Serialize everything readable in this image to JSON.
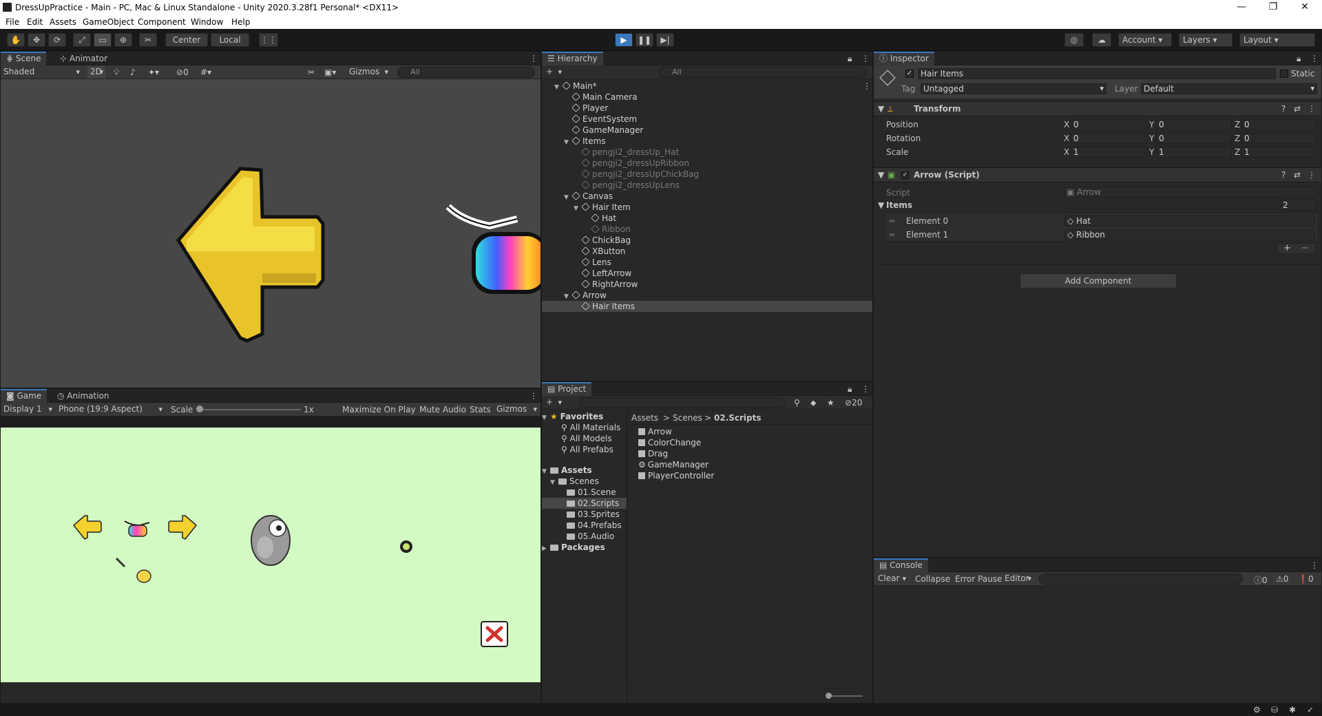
{
  "window": {
    "title": "DressUpPractice - Main - PC, Mac & Linux Standalone - Unity 2020.3.28f1 Personal* <DX11>"
  },
  "menu": [
    "File",
    "Edit",
    "Assets",
    "GameObject",
    "Component",
    "Window",
    "Help"
  ],
  "toolbar": {
    "center": "Center",
    "local": "Local",
    "account": "Account",
    "layers": "Layers",
    "layout": "Layout"
  },
  "scene": {
    "tabs": [
      "Scene",
      "Animator"
    ],
    "shading": "Shaded",
    "mode2d": "2D",
    "hidden_count": "0",
    "gizmos": "Gizmos",
    "search_placeholder": "All"
  },
  "hierarchy": {
    "tab": "Hierarchy",
    "search_placeholder": "All",
    "items": [
      {
        "label": "Main*",
        "level": 0,
        "fold": "open",
        "kind": "scene"
      },
      {
        "label": "Main Camera",
        "level": 1
      },
      {
        "label": "Player",
        "level": 1
      },
      {
        "label": "EventSystem",
        "level": 1
      },
      {
        "label": "GameManager",
        "level": 1
      },
      {
        "label": "Items",
        "level": 1,
        "fold": "open"
      },
      {
        "label": "pengji2_dressUp_Hat",
        "level": 2,
        "dim": true
      },
      {
        "label": "pengji2_dressUpRibbon",
        "level": 2,
        "dim": true
      },
      {
        "label": "pengji2_dressUpChickBag",
        "level": 2,
        "dim": true
      },
      {
        "label": "pengji2_dressUpLens",
        "level": 2,
        "dim": true
      },
      {
        "label": "Canvas",
        "level": 1,
        "fold": "open"
      },
      {
        "label": "Hair Item",
        "level": 2,
        "fold": "open"
      },
      {
        "label": "Hat",
        "level": 3
      },
      {
        "label": "Ribbon",
        "level": 3,
        "dim": true
      },
      {
        "label": "ChickBag",
        "level": 2
      },
      {
        "label": "XButton",
        "level": 2
      },
      {
        "label": "Lens",
        "level": 2
      },
      {
        "label": "LeftArrow",
        "level": 2
      },
      {
        "label": "RightArrow",
        "level": 2
      },
      {
        "label": "Arrow",
        "level": 1,
        "fold": "open"
      },
      {
        "label": "Hair Items",
        "level": 2,
        "selected": true
      }
    ]
  },
  "inspector": {
    "tab": "Inspector",
    "object_name": "Hair Items",
    "static_label": "Static",
    "tag_label": "Tag",
    "tag_value": "Untagged",
    "layer_label": "Layer",
    "layer_value": "Default",
    "transform": {
      "title": "Transform",
      "rows": [
        {
          "label": "Position",
          "x": "0",
          "y": "0",
          "z": "0"
        },
        {
          "label": "Rotation",
          "x": "0",
          "y": "0",
          "z": "0"
        },
        {
          "label": "Scale",
          "x": "1",
          "y": "1",
          "z": "1"
        }
      ]
    },
    "script_comp": {
      "title": "Arrow (Script)",
      "script_label": "Script",
      "script_value": "Arrow",
      "items_label": "Items",
      "items_count": "2",
      "elements": [
        {
          "label": "Element 0",
          "value": "Hat"
        },
        {
          "label": "Element 1",
          "value": "Ribbon"
        }
      ]
    },
    "add_component": "Add Component",
    "axes": {
      "x": "X",
      "y": "Y",
      "z": "Z"
    }
  },
  "game": {
    "tabs": [
      "Game",
      "Animation"
    ],
    "display": "Display 1",
    "aspect": "Phone (19:9 Aspect)",
    "scale_label": "Scale",
    "scale_value": "1x",
    "maximize": "Maximize On Play",
    "mute": "Mute Audio",
    "stats": "Stats",
    "gizmos": "Gizmos",
    "bg_color": "#d3fac3"
  },
  "project": {
    "tab": "Project",
    "hidden_count": "20",
    "breadcrumb": [
      "Assets",
      "Scenes",
      "02.Scripts"
    ],
    "favorites": {
      "label": "Favorites",
      "items": [
        "All Materials",
        "All Models",
        "All Prefabs"
      ]
    },
    "assets_label": "Assets",
    "scenes_label": "Scenes",
    "folders": [
      "01.Scene",
      "02.Scripts",
      "03.Sprites",
      "04.Prefabs",
      "05.Audio"
    ],
    "packages_label": "Packages",
    "files": [
      {
        "name": "Arrow",
        "icon": "script-icon"
      },
      {
        "name": "ColorChange",
        "icon": "script-icon"
      },
      {
        "name": "Drag",
        "icon": "script-icon"
      },
      {
        "name": "GameManager",
        "icon": "gear-icon"
      },
      {
        "name": "PlayerController",
        "icon": "script-icon"
      }
    ]
  },
  "console": {
    "tab": "Console",
    "clear": "Clear",
    "collapse": "Collapse",
    "error_pause": "Error Pause",
    "editor": "Editor",
    "log_count": "0",
    "warn_count": "0",
    "error_count": "0"
  },
  "colors": {
    "accent": "#3a79bb",
    "arrow_yellow": "#f3d12f",
    "selected_row": "#464646"
  }
}
